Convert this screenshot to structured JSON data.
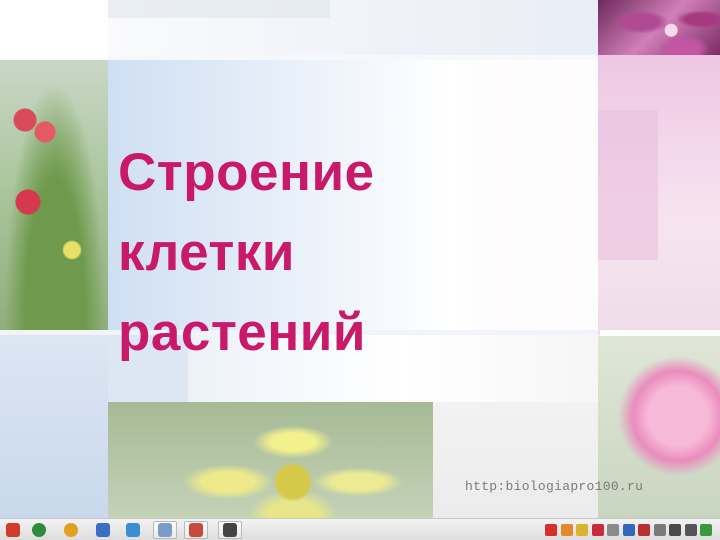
{
  "slide": {
    "title_lines": [
      "Строение",
      "клетки",
      "растений"
    ],
    "watermark": "http:biologiapro100.ru"
  },
  "colors": {
    "title": "#c8196b"
  },
  "taskbar": {
    "left_icons": [
      {
        "name": "start-icon",
        "color": "#d23c2c"
      },
      {
        "name": "browser-icon",
        "color": "#2e8b3e"
      },
      {
        "name": "chrome-icon",
        "color": "#e0a020"
      },
      {
        "name": "document-icon",
        "color": "#3a6fc4"
      },
      {
        "name": "search-icon",
        "color": "#3a8fd0"
      }
    ],
    "buttons": [
      {
        "name": "presentation-window-icon",
        "color": "#7a9cc8"
      },
      {
        "name": "app-window-icon",
        "color": "#c84a3a"
      },
      {
        "name": "media-window-icon",
        "color": "#444444"
      }
    ],
    "tray_icons": [
      {
        "name": "tray-red-icon",
        "color": "#d4302c"
      },
      {
        "name": "tray-orange-icon",
        "color": "#e08a2a"
      },
      {
        "name": "tray-yellow-icon",
        "color": "#d8b430"
      },
      {
        "name": "tray-red2-icon",
        "color": "#c82c3a"
      },
      {
        "name": "tray-gray-icon",
        "color": "#8a8a8a"
      },
      {
        "name": "tray-blue-icon",
        "color": "#3468b8"
      },
      {
        "name": "tray-red3-icon",
        "color": "#b83030"
      },
      {
        "name": "tray-gray2-icon",
        "color": "#7a7a7a"
      },
      {
        "name": "tray-network-icon",
        "color": "#4a4a4a"
      },
      {
        "name": "tray-volume-icon",
        "color": "#555555"
      },
      {
        "name": "tray-green-icon",
        "color": "#3a9a3a"
      }
    ]
  }
}
